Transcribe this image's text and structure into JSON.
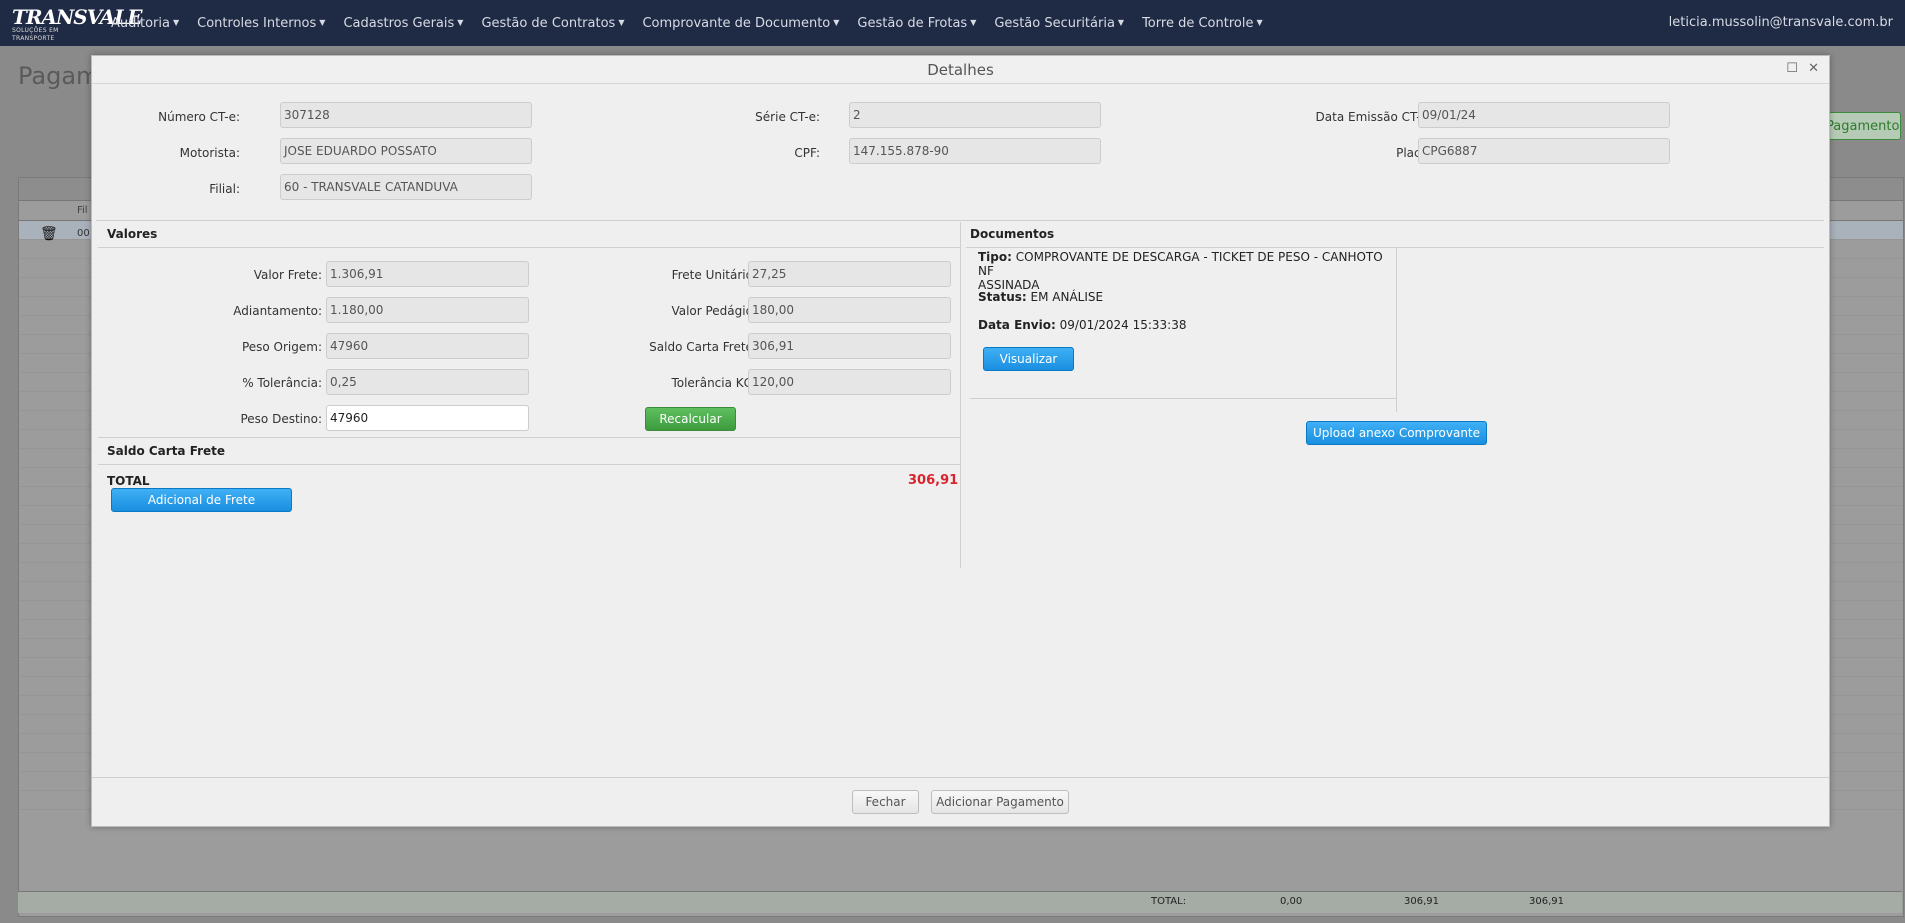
{
  "nav": {
    "logo_main": "TRANSVALE",
    "logo_sub": "SOLUÇÕES EM TRANSPORTE",
    "menu": [
      {
        "label": "Auditoria"
      },
      {
        "label": "Controles Internos"
      },
      {
        "label": "Cadastros Gerais"
      },
      {
        "label": "Gestão de Contratos"
      },
      {
        "label": "Comprovante de Documento"
      },
      {
        "label": "Gestão de Frotas"
      },
      {
        "label": "Gestão Securitária"
      },
      {
        "label": "Torre de Controle"
      }
    ],
    "user": "leticia.mussolin@transvale.com.br"
  },
  "background": {
    "page_title": "Pagame",
    "button_label": "Pagamento",
    "grid_sub_header": "Fil",
    "row_prefix": "00",
    "total_label": "TOTAL:",
    "total_values": [
      "0,00",
      "306,91",
      "306,91"
    ]
  },
  "modal": {
    "title": "Detalhes",
    "header": {
      "numero_cte_label": "Número CT-e:",
      "numero_cte_value": "307128",
      "serie_cte_label": "Série CT-e:",
      "serie_cte_value": "2",
      "data_emissao_label": "Data Emissão CT-e:",
      "data_emissao_value": "09/01/24",
      "motorista_label": "Motorista:",
      "motorista_value": "JOSE EDUARDO POSSATO",
      "cpf_label": "CPF:",
      "cpf_value": "147.155.878-90",
      "placa_label": "Placa:",
      "placa_value": "CPG6887",
      "filial_label": "Filial:",
      "filial_value": "60 - TRANSVALE CATANDUVA"
    },
    "valores": {
      "title": "Valores",
      "valor_frete_label": "Valor Frete:",
      "valor_frete_value": "1.306,91",
      "frete_unitario_label": "Frete Unitário:",
      "frete_unitario_value": "27,25",
      "adiantamento_label": "Adiantamento:",
      "adiantamento_value": "1.180,00",
      "valor_pedagio_label": "Valor Pedágio:",
      "valor_pedagio_value": "180,00",
      "peso_origem_label": "Peso Origem:",
      "peso_origem_value": "47960",
      "saldo_carta_label": "Saldo Carta Frete:",
      "saldo_carta_value": "306,91",
      "tolerancia_pct_label": "% Tolerância:",
      "tolerancia_pct_value": "0,25",
      "tolerancia_kg_label": "Tolerância KG:",
      "tolerancia_kg_value": "120,00",
      "peso_destino_label": "Peso Destino:",
      "peso_destino_value": "47960",
      "recalcular_label": "Recalcular"
    },
    "saldo": {
      "title": "Saldo Carta Frete",
      "total_label": "TOTAL",
      "total_value": "306,91",
      "adicional_label": "Adicional de Frete"
    },
    "documentos": {
      "title": "Documentos",
      "tipo_label": "Tipo:",
      "tipo_value_line1": "COMPROVANTE DE DESCARGA - TICKET DE PESO - CANHOTO NF",
      "tipo_value_line2": "ASSINADA",
      "status_label": "Status:",
      "status_value": "EM ANÁLISE",
      "data_envio_label": "Data Envio:",
      "data_envio_value": "09/01/2024 15:33:38",
      "visualizar_label": "Visualizar",
      "upload_label": "Upload anexo Comprovante"
    },
    "footer": {
      "fechar_label": "Fechar",
      "adicionar_label": "Adicionar Pagamento"
    }
  }
}
